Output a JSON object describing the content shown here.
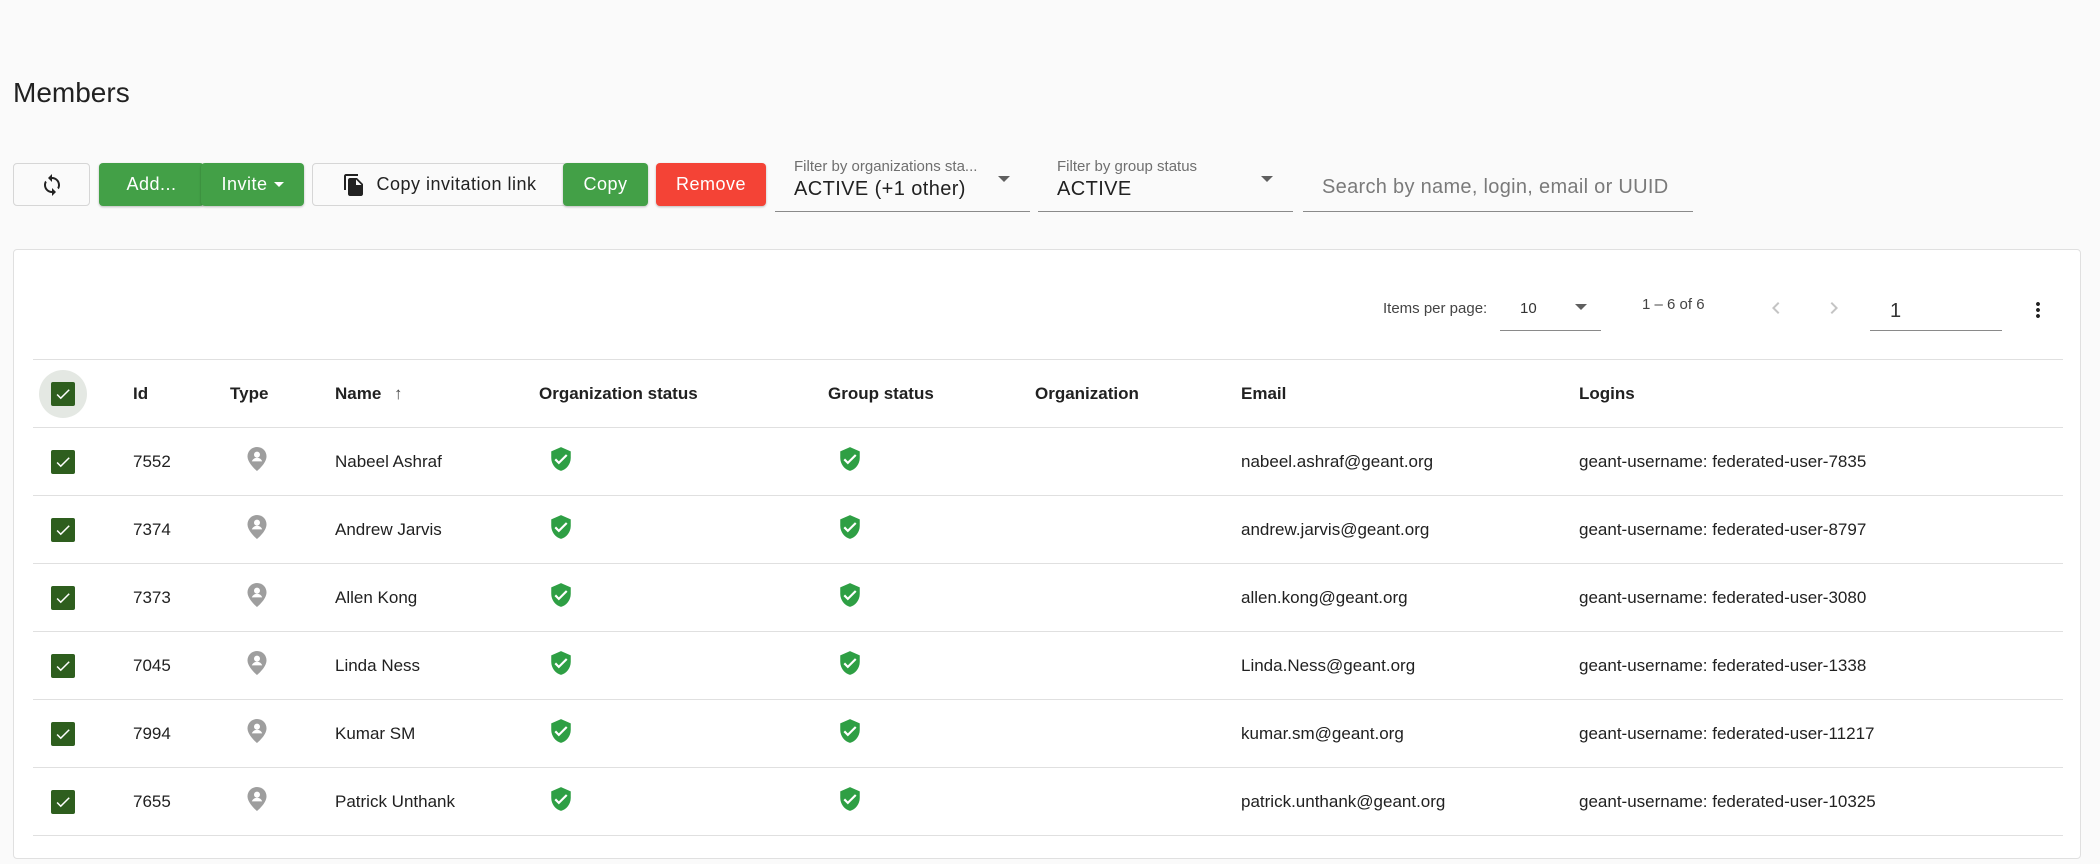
{
  "page": {
    "title": "Members"
  },
  "toolbar": {
    "refresh_icon": "refresh-icon",
    "add_label": "Add...",
    "invite_label": "Invite",
    "copy_invitation_link_label": "Copy invitation link",
    "copy_label": "Copy",
    "remove_label": "Remove",
    "colors": {
      "green": "#43a047",
      "red": "#f44336"
    }
  },
  "filters": {
    "organization_status": {
      "label": "Filter by organizations sta...",
      "value": "ACTIVE (+1 other)"
    },
    "group_status": {
      "label": "Filter by group status",
      "value": "ACTIVE"
    },
    "search": {
      "placeholder": "Search by name, login, email or UUID",
      "value": ""
    }
  },
  "paginator": {
    "items_per_page_label": "Items per page:",
    "items_per_page_value": "10",
    "range_label": "1 – 6 of 6",
    "page_value": "1"
  },
  "table": {
    "columns": {
      "id": "Id",
      "type": "Type",
      "name": "Name",
      "organization_status": "Organization status",
      "group_status": "Group status",
      "organization": "Organization",
      "email": "Email",
      "logins": "Logins"
    },
    "sort": {
      "column": "name",
      "direction": "ascending"
    },
    "status_color": "#2e9f44",
    "rows": [
      {
        "selected": true,
        "id": "7552",
        "type_icon": "person-pin-icon",
        "name": "Nabeel Ashraf",
        "organization_status": "active",
        "group_status": "active",
        "organization": "",
        "email": "nabeel.ashraf@geant.org",
        "logins": "geant-username: federated-user-7835"
      },
      {
        "selected": true,
        "id": "7374",
        "type_icon": "person-pin-icon",
        "name": "Andrew Jarvis",
        "organization_status": "active",
        "group_status": "active",
        "organization": "",
        "email": "andrew.jarvis@geant.org",
        "logins": "geant-username: federated-user-8797"
      },
      {
        "selected": true,
        "id": "7373",
        "type_icon": "person-pin-icon",
        "name": "Allen Kong",
        "organization_status": "active",
        "group_status": "active",
        "organization": "",
        "email": "allen.kong@geant.org",
        "logins": "geant-username: federated-user-3080"
      },
      {
        "selected": true,
        "id": "7045",
        "type_icon": "person-pin-icon",
        "name": "Linda Ness",
        "organization_status": "active",
        "group_status": "active",
        "organization": "",
        "email": "Linda.Ness@geant.org",
        "logins": "geant-username: federated-user-1338"
      },
      {
        "selected": true,
        "id": "7994",
        "type_icon": "person-pin-icon",
        "name": "Kumar SM",
        "organization_status": "active",
        "group_status": "active",
        "organization": "",
        "email": "kumar.sm@geant.org",
        "logins": "geant-username: federated-user-11217"
      },
      {
        "selected": true,
        "id": "7655",
        "type_icon": "person-pin-icon",
        "name": "Patrick Unthank",
        "organization_status": "active",
        "group_status": "active",
        "organization": "",
        "email": "patrick.unthank@geant.org",
        "logins": "geant-username: federated-user-10325"
      }
    ]
  }
}
